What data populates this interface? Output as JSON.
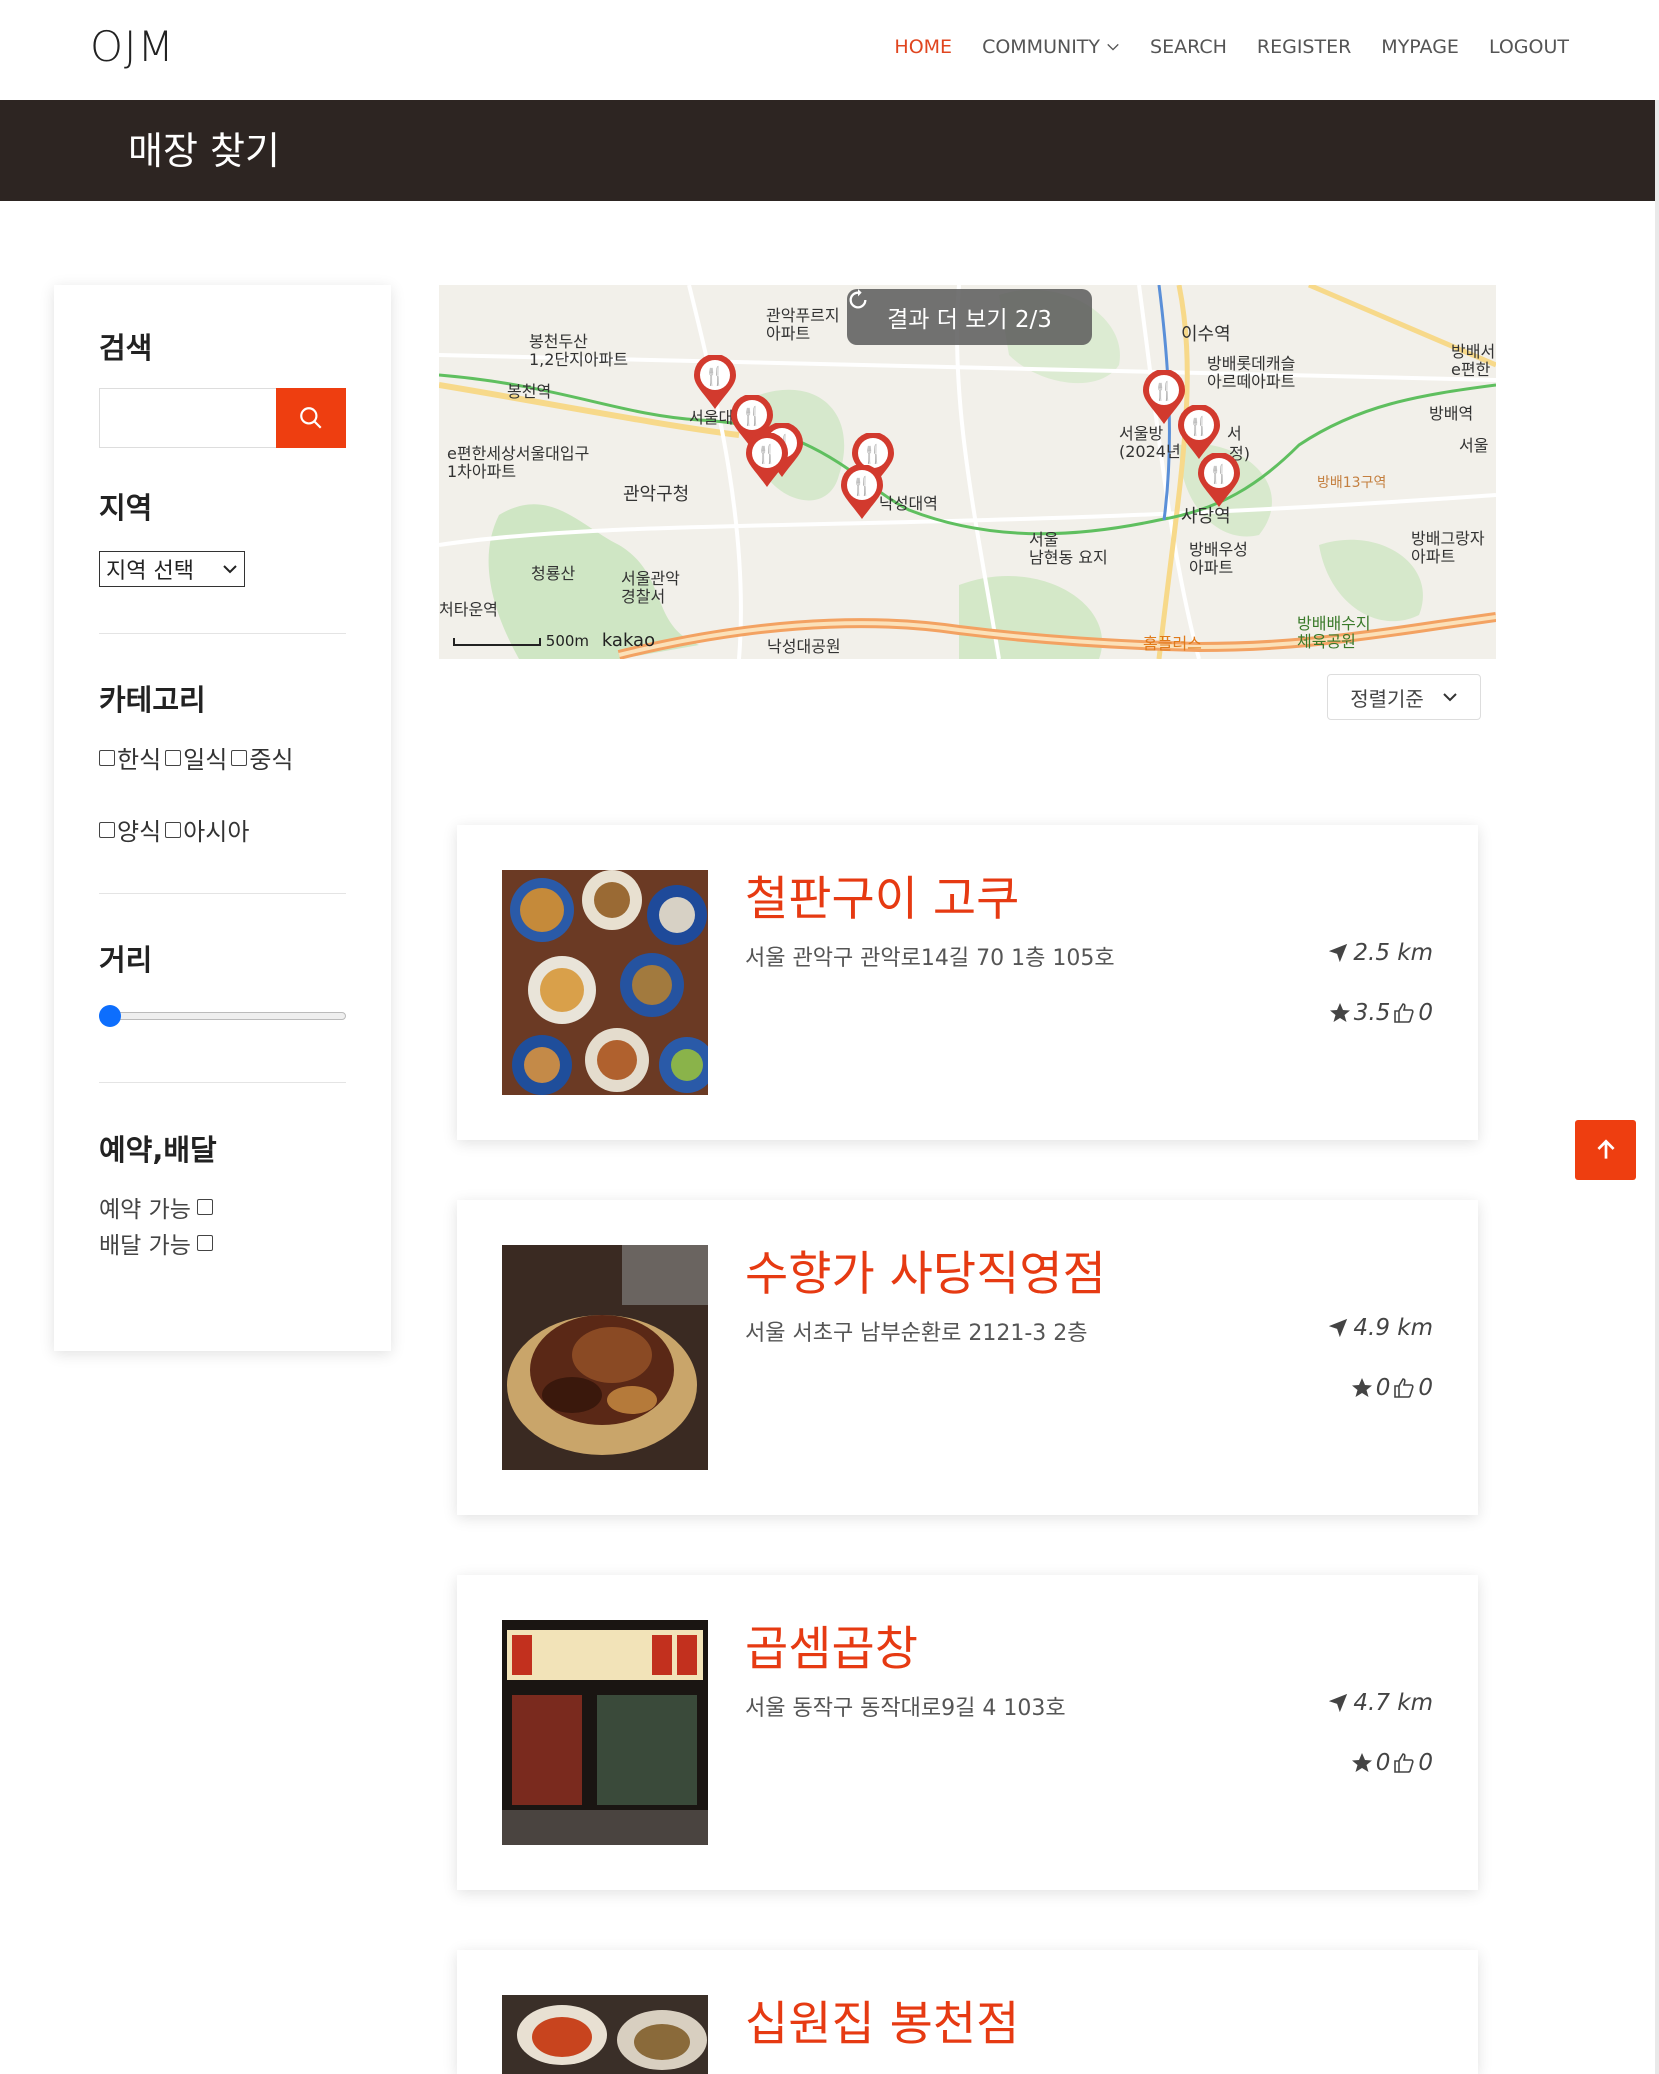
{
  "nav": {
    "logo": "OJM",
    "links": [
      {
        "label": "HOME",
        "active": true
      },
      {
        "label": "COMMUNITY"
      },
      {
        "label": "SEARCH"
      },
      {
        "label": "REGISTER"
      },
      {
        "label": "MYPAGE"
      },
      {
        "label": "LOGOUT"
      }
    ]
  },
  "page": {
    "title": "매장 찾기"
  },
  "sidebar": {
    "search_title": "검색",
    "search_value": "",
    "region_title": "지역",
    "region_select": "지역 선택",
    "category_title": "카테고리",
    "categories_row1": [
      "한식",
      "일식",
      "중식"
    ],
    "categories_row2": [
      "양식",
      "아시아"
    ],
    "distance_title": "거리",
    "distance_value": 0,
    "options_title": "예약,배달",
    "option_reserve": "예약 가능",
    "option_delivery": "배달 가능"
  },
  "map": {
    "more_button": "결과 더 보기 2/3",
    "scale": "500m",
    "brand": "kakao",
    "labels": {
      "l1": "봉천두산\n1,2단지아파트",
      "l2": "봉천역",
      "l3": "관악푸르지\n아파트",
      "l4": "e편한세상서울대입구\n1차아파트",
      "l5": "관악구청",
      "l6": "청룡산",
      "l7": "서울관악\n경찰서",
      "l8": "처타운역",
      "l9": "낙성대공원",
      "l10": "낙성대역",
      "l11": "이수역",
      "l12": "방배롯데캐슬\n아르떼아파트",
      "l13": "사당역",
      "l14": "서울\n남현동 요지",
      "l15": "방배우성\n아파트",
      "l16": "방배13구역",
      "l17": "방배그랑자\n아파트",
      "l18": "방배역",
      "l19": "방배배수지\n체육공원",
      "l20": "홈플러스",
      "l21": "서울",
      "l22": "방배서\ne편한",
      "l23": "서울대",
      "l24": "서울방\n(2024년",
      "l25": "서",
      "l26": "정)"
    }
  },
  "sort": {
    "label": "정렬기준"
  },
  "stores": [
    {
      "name": "철판구이 고쿠",
      "address": "서울 관악구 관악로14길 70 1층 105호",
      "distance": "2.5 km",
      "rating": "3.5",
      "likes": "0"
    },
    {
      "name": "수향가 사당직영점",
      "address": "서울 서초구 남부순환로 2121-3 2층",
      "distance": "4.9 km",
      "rating": "0",
      "likes": "0"
    },
    {
      "name": "곱셈곱창",
      "address": "서울 동작구 동작대로9길 4 103호",
      "distance": "4.7 km",
      "rating": "0",
      "likes": "0"
    },
    {
      "name": "십원집 봉천점",
      "address": "",
      "distance": "",
      "rating": "",
      "likes": ""
    }
  ],
  "colors": {
    "accent": "#e63a12",
    "band": "#2d2522",
    "button": "#ee3e10"
  }
}
